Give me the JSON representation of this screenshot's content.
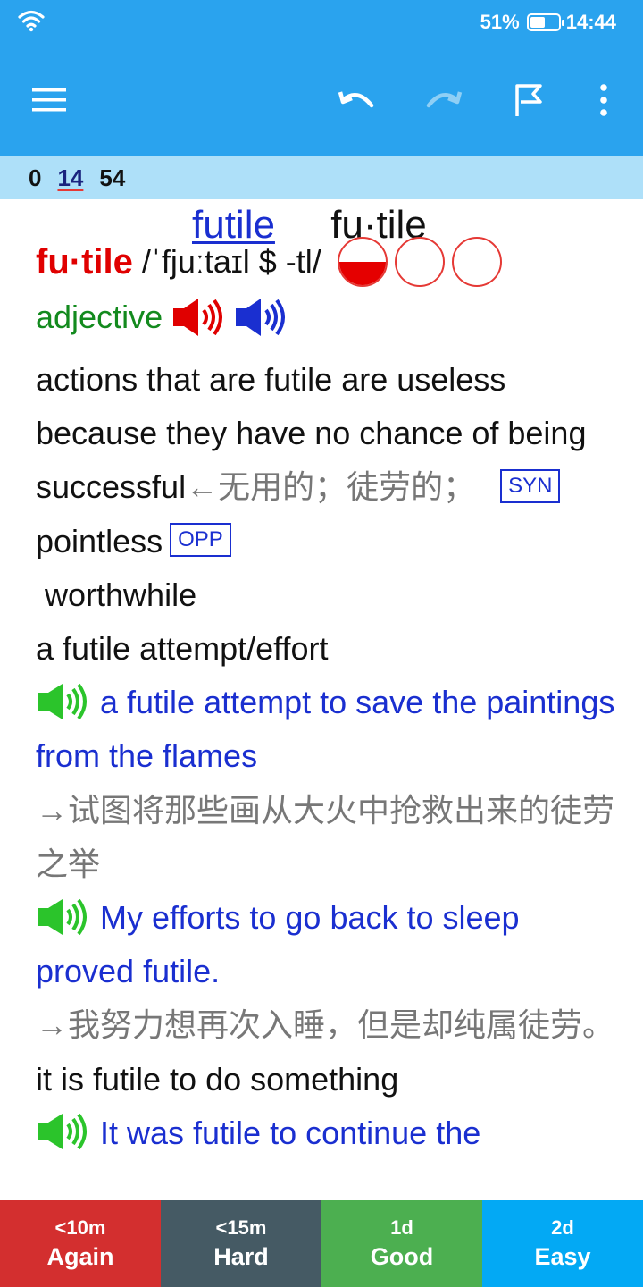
{
  "status_bar": {
    "battery_text": "51%",
    "time": "14:44",
    "icons": [
      "wifi-icon",
      "battery-icon"
    ]
  },
  "toolbar": {
    "icons": [
      "menu-icon",
      "undo-icon",
      "redo-icon",
      "flag-icon",
      "more-vertical-icon"
    ]
  },
  "counts": {
    "new": "0",
    "learn": "14",
    "review": "54"
  },
  "card": {
    "top_link_word": "futile",
    "top_plain_word": "fu·tile",
    "headword": "fu·tile",
    "pronunciation": "/ˈfjuːtaɪl $ -tl/",
    "part_of_speech": "adjective",
    "definition": "actions that are futile are useless because they have no chance of being successful",
    "definition_zh": "←无用的；徒劳的；",
    "syn_tag": "SYN",
    "synonym": "pointless",
    "opp_tag": "OPP",
    "antonym": "worthwhile",
    "pattern1": "a futile attempt/effort",
    "example1": "a futile attempt to save the paintings from the flames",
    "example1_zh": "→试图将那些画从大火中抢救出来的徒劳之举",
    "example2": "My efforts to go back to sleep proved futile.",
    "example2_zh": "→我努力想再次入睡，但是却纯属徒劳。",
    "pattern2": "it is futile to do something",
    "example3": "It was futile to continue the",
    "colors": {
      "headword": "#e00000",
      "part_of_speech": "#138a1e",
      "example": "#1a2fd0",
      "translation": "#777777"
    }
  },
  "answers": [
    {
      "interval": "<10m",
      "label": "Again",
      "color": "#d32f2f"
    },
    {
      "interval": "<15m",
      "label": "Hard",
      "color": "#455a64"
    },
    {
      "interval": "1d",
      "label": "Good",
      "color": "#4caf50"
    },
    {
      "interval": "2d",
      "label": "Easy",
      "color": "#03a9f4"
    }
  ]
}
